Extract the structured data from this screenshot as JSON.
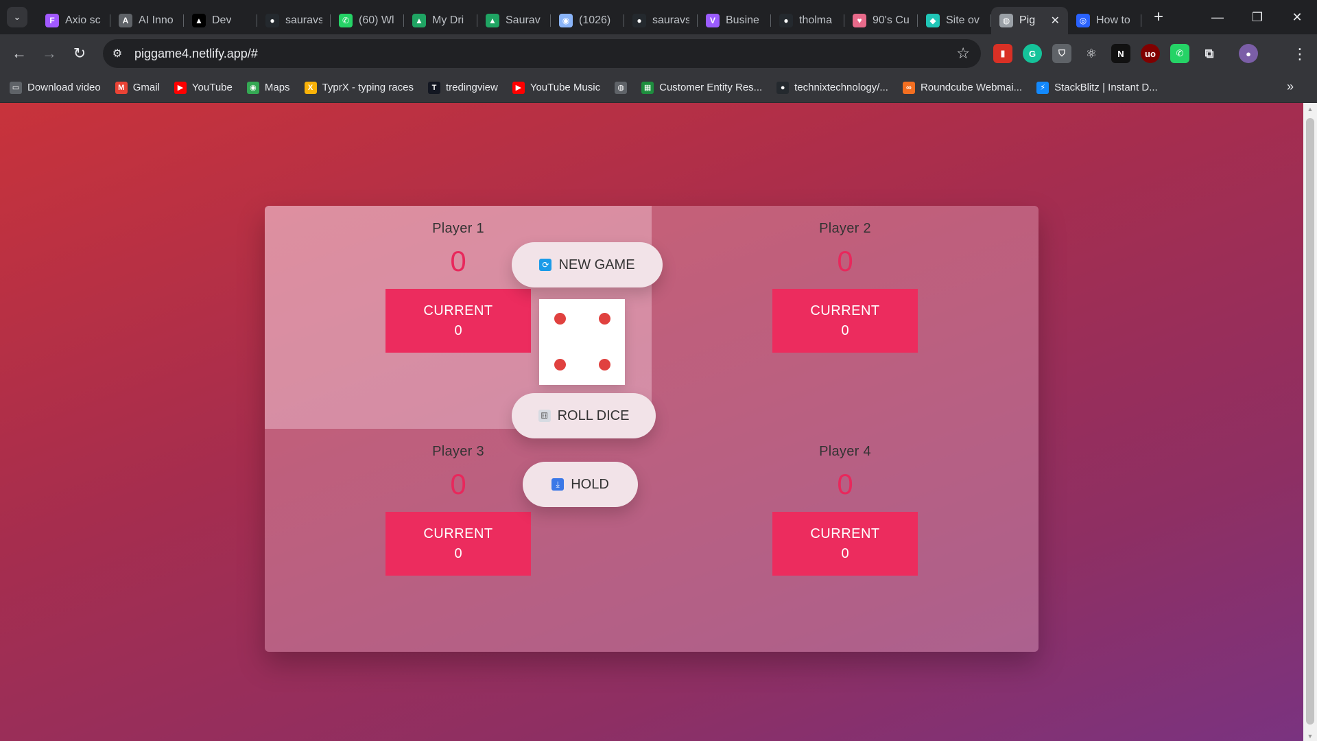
{
  "browser": {
    "tabs": [
      {
        "title": "Axio sc",
        "icon": "figma-icon",
        "color": "#a259ff"
      },
      {
        "title": "AI Inno",
        "icon": "ai-icon",
        "color": "#5f6368"
      },
      {
        "title": "Dev",
        "icon": "vercel-icon",
        "color": "#000000"
      },
      {
        "title": "sauravs",
        "icon": "github-icon",
        "color": "#24292e"
      },
      {
        "title": "(60) Wl",
        "icon": "whatsapp-icon",
        "color": "#25d366"
      },
      {
        "title": "My Dri",
        "icon": "drive-icon",
        "color": "#1fa463"
      },
      {
        "title": "Saurav",
        "icon": "drive-icon",
        "color": "#1fa463"
      },
      {
        "title": "(1026)",
        "icon": "chat-icon",
        "color": "#8ab4f8"
      },
      {
        "title": "sauravs",
        "icon": "github-icon",
        "color": "#24292e"
      },
      {
        "title": "Busine",
        "icon": "vite-icon",
        "color": "#9b5cff"
      },
      {
        "title": "tholma",
        "icon": "github-icon",
        "color": "#24292e"
      },
      {
        "title": "90's Cu",
        "icon": "mouse-icon",
        "color": "#e86a8a"
      },
      {
        "title": "Site ov",
        "icon": "netlify-icon",
        "color": "#20c6b7"
      },
      {
        "title": "Pig",
        "icon": "globe-icon",
        "color": "#9aa0a6",
        "active": true
      },
      {
        "title": "How to",
        "icon": "hashnode-icon",
        "color": "#2962ff"
      }
    ],
    "new_tab": "+",
    "window": {
      "minimize": "—",
      "restore": "❐",
      "close": "✕"
    },
    "url": "piggame4.netlify.app/#",
    "bookmarks": [
      {
        "label": "Download video",
        "icon": "folder-icon",
        "color": "#5f6368"
      },
      {
        "label": "Gmail",
        "icon": "gmail-icon",
        "color": "#ea4335"
      },
      {
        "label": "YouTube",
        "icon": "youtube-icon",
        "color": "#ff0000"
      },
      {
        "label": "Maps",
        "icon": "maps-icon",
        "color": "#34a853"
      },
      {
        "label": "TyprX - typing races",
        "icon": "typrx-icon",
        "color": "#f9b208"
      },
      {
        "label": "tredingview",
        "icon": "tradingview-icon",
        "color": "#131722"
      },
      {
        "label": "YouTube Music",
        "icon": "youtube-music-icon",
        "color": "#ff0000"
      },
      {
        "label": "",
        "icon": "globe-icon",
        "color": "#5f6368"
      },
      {
        "label": "Customer Entity Res...",
        "icon": "sheet-icon",
        "color": "#1e8e3e"
      },
      {
        "label": "technixtechnology/...",
        "icon": "github-icon",
        "color": "#24292e"
      },
      {
        "label": "Roundcube Webmai...",
        "icon": "roundcube-icon",
        "color": "#f36f21"
      },
      {
        "label": "StackBlitz | Instant D...",
        "icon": "stackblitz-icon",
        "color": "#1389fd"
      }
    ]
  },
  "game": {
    "players": [
      {
        "name": "Player 1",
        "score": "0",
        "current_label": "CURRENT",
        "current": "0",
        "active": true
      },
      {
        "name": "Player 2",
        "score": "0",
        "current_label": "CURRENT",
        "current": "0",
        "active": false
      },
      {
        "name": "Player 3",
        "score": "0",
        "current_label": "CURRENT",
        "current": "0",
        "active": false
      },
      {
        "name": "Player 4",
        "score": "0",
        "current_label": "CURRENT",
        "current": "0",
        "active": false
      }
    ],
    "buttons": {
      "new_game": "NEW GAME",
      "roll_dice": "ROLL DICE",
      "hold": "HOLD"
    },
    "dice_value": 4,
    "accent_color": "#ec2c5e"
  }
}
